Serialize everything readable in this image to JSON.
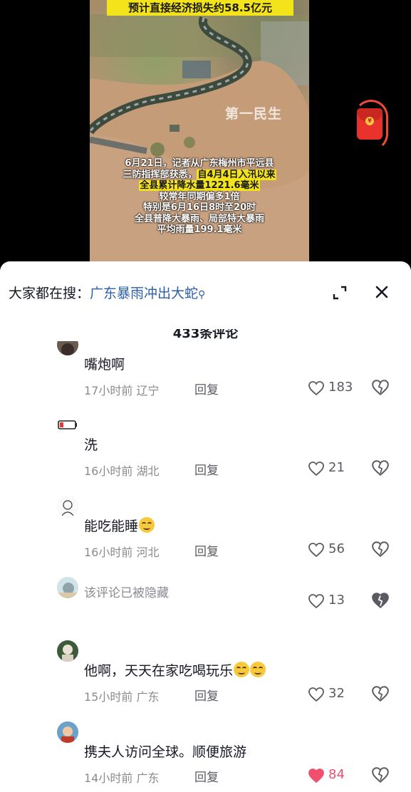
{
  "video": {
    "top_caption": "预计直接经济损失约58.5亿元",
    "watermark": "第一民生",
    "subtitle_lines": [
      {
        "parts": [
          {
            "t": "6月21日，记者从广东梅州市平远县",
            "hl": false
          }
        ]
      },
      {
        "parts": [
          {
            "t": "三防指挥部获悉，",
            "hl": false
          },
          {
            "t": "自4月4日入汛以来",
            "hl": true
          }
        ]
      },
      {
        "parts": [
          {
            "t": "全县累计降水量1221.6毫米",
            "hl": true
          }
        ]
      },
      {
        "parts": [
          {
            "t": "较常年同期偏多1倍",
            "hl": false
          }
        ]
      },
      {
        "parts": [
          {
            "t": "特别是6月16日8时至20时",
            "hl": false
          }
        ]
      },
      {
        "parts": [
          {
            "t": "全县普降大暴雨、局部特大暴雨",
            "hl": false
          }
        ]
      },
      {
        "parts": [
          {
            "t": "平均雨量199.1毫米",
            "hl": false
          }
        ]
      }
    ]
  },
  "search": {
    "label": "大家都在搜：",
    "query": "广东暴雨冲出大蛇",
    "icon": "search-icon"
  },
  "panel": {
    "comment_count": "433条评论"
  },
  "comments": [
    {
      "text": "嘴炮啊",
      "emojis": 0,
      "time": "17小时前",
      "region": "辽宁",
      "reply": "回复",
      "likes": "183",
      "liked": false,
      "hidden": false
    },
    {
      "text": "洗",
      "emojis": 0,
      "time": "16小时前",
      "region": "湖北",
      "reply": "回复",
      "likes": "21",
      "liked": false,
      "hidden": false
    },
    {
      "text": "能吃能睡",
      "emojis": 1,
      "time": "16小时前",
      "region": "河北",
      "reply": "回复",
      "likes": "56",
      "liked": false,
      "hidden": false
    },
    {
      "text": "该评论已被隐藏",
      "emojis": 0,
      "time": "",
      "region": "",
      "reply": "",
      "likes": "13",
      "liked": false,
      "hidden": true
    },
    {
      "text": "他啊，天天在家吃喝玩乐",
      "emojis": 2,
      "time": "15小时前",
      "region": "广东",
      "reply": "回复",
      "likes": "32",
      "liked": false,
      "hidden": false
    },
    {
      "text": "携夫人访问全球。顺便旅游",
      "emojis": 0,
      "time": "14小时前",
      "region": "广东",
      "reply": "回复",
      "likes": "84",
      "liked": true,
      "hidden": false
    }
  ],
  "colors": {
    "link_blue": "#2b5fa8",
    "like_pink": "#f0506e",
    "highlight_yellow": "#f3e31a",
    "redpacket_red": "#e8322b"
  }
}
